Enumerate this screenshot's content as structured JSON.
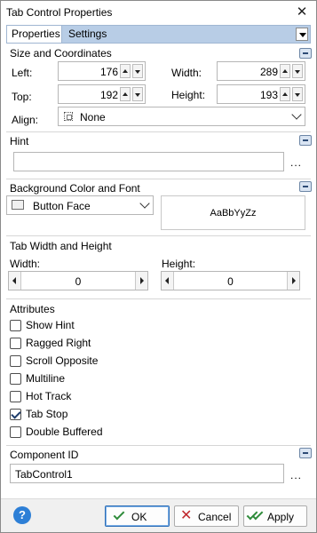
{
  "window": {
    "title": "Tab Control Properties"
  },
  "tabs": [
    {
      "label": "Properties",
      "active": true
    },
    {
      "label": "Settings",
      "active": false
    }
  ],
  "size_coords": {
    "title": "Size and Coordinates",
    "left": {
      "label": "Left:",
      "value": "176"
    },
    "width": {
      "label": "Width:",
      "value": "289"
    },
    "top": {
      "label": "Top:",
      "value": "192"
    },
    "height": {
      "label": "Height:",
      "value": "193"
    },
    "align": {
      "label": "Align:",
      "value": "None"
    }
  },
  "hint": {
    "title": "Hint",
    "value": "",
    "ellipsis": "..."
  },
  "bg_font": {
    "title": "Background Color and Font",
    "color": "Button Face",
    "preview": "AaBbYyZz"
  },
  "tab_wh": {
    "title": "Tab Width and Height",
    "width": {
      "label": "Width:",
      "value": "0"
    },
    "height": {
      "label": "Height:",
      "value": "0"
    }
  },
  "attributes": {
    "title": "Attributes",
    "items": [
      {
        "label": "Show Hint",
        "checked": false
      },
      {
        "label": "Ragged Right",
        "checked": false
      },
      {
        "label": "Scroll Opposite",
        "checked": false
      },
      {
        "label": "Multiline",
        "checked": false
      },
      {
        "label": "Hot Track",
        "checked": false
      },
      {
        "label": "Tab Stop",
        "checked": true
      },
      {
        "label": "Double Buffered",
        "checked": false
      }
    ]
  },
  "component": {
    "title": "Component ID",
    "value": "TabControl1",
    "ellipsis": "..."
  },
  "footer": {
    "help": "?",
    "ok": "OK",
    "cancel": "Cancel",
    "apply": "Apply"
  },
  "colors": {
    "tab_strip": "#b8cde6",
    "accent": "#2d7fd6",
    "ok_green": "#2e8b3a",
    "cancel_red": "#c0282d"
  }
}
